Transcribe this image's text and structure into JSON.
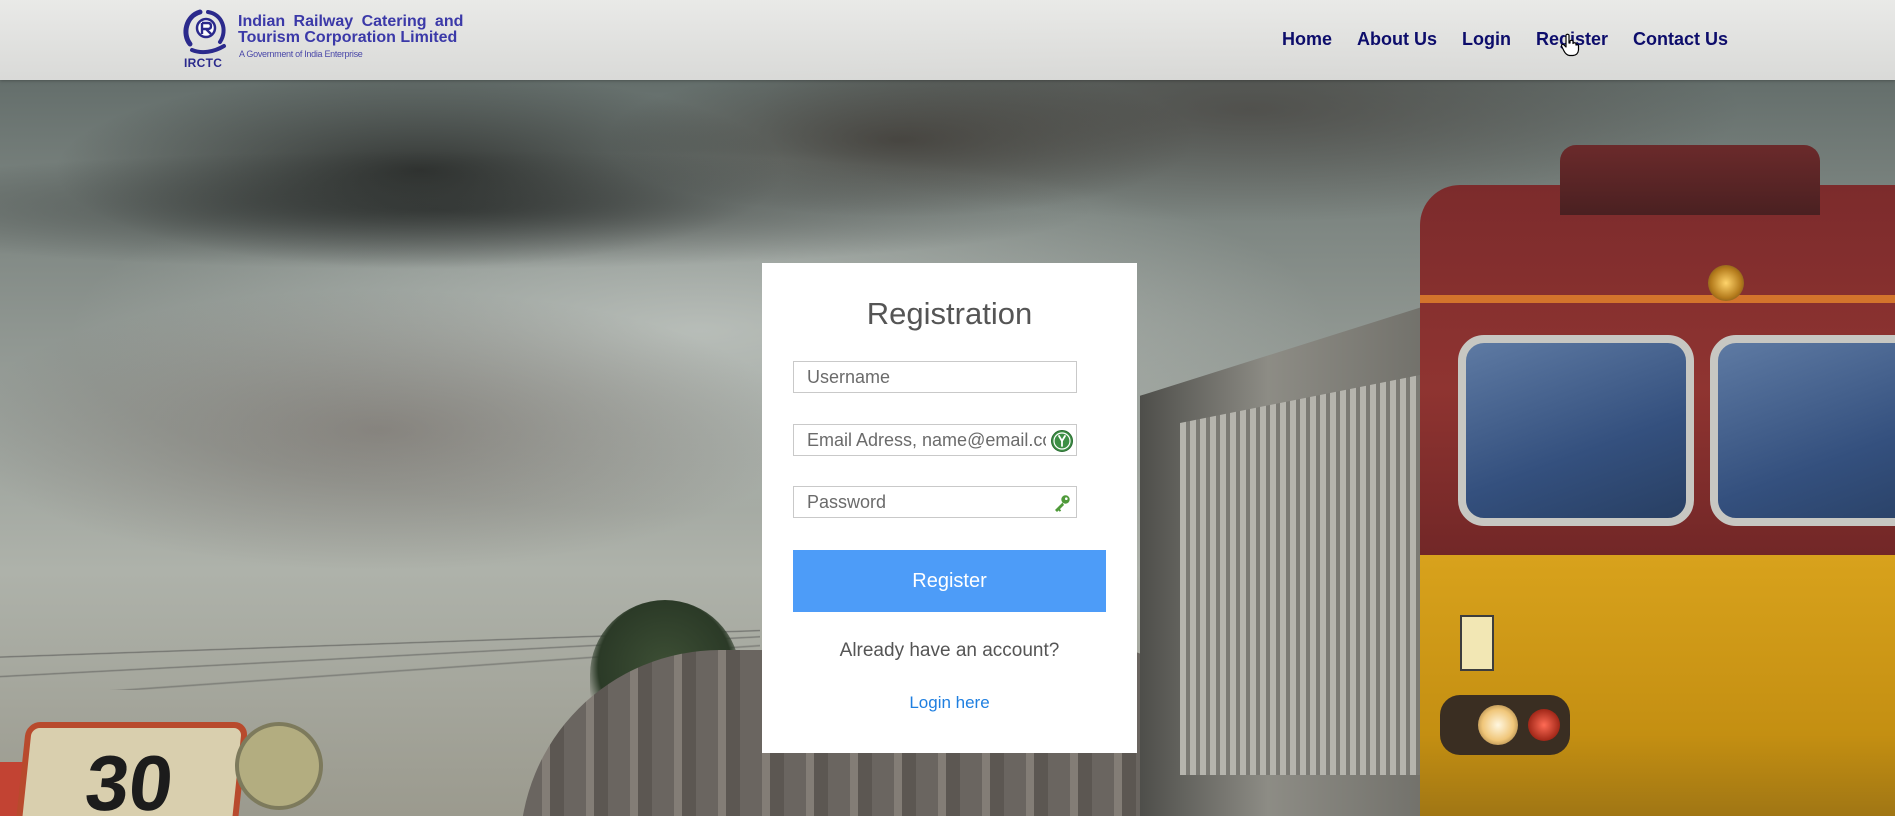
{
  "header": {
    "logo": {
      "abbr": "IRCTC",
      "title_line1": "Indian Railway Catering and",
      "title_line2": "Tourism Corporation Limited",
      "subtitle": "A Government of India Enterprise",
      "brand_color": "#3b39a8"
    },
    "nav": {
      "items": [
        {
          "label": "Home"
        },
        {
          "label": "About Us"
        },
        {
          "label": "Login"
        },
        {
          "label": "Register"
        },
        {
          "label": "Contact Us"
        }
      ],
      "color": "#0d0d6b"
    }
  },
  "registration": {
    "title": "Registration",
    "username": {
      "value": "",
      "placeholder": "Username"
    },
    "email": {
      "value": "",
      "placeholder": "Email Adress, name@email.com",
      "icon": "password-manager-icon"
    },
    "password": {
      "value": "",
      "placeholder": "Password",
      "icon": "key-icon"
    },
    "submit_label": "Register",
    "already_text": "Already have an account?",
    "login_link_label": "Login here",
    "accent_color": "#4d9cf8",
    "link_color": "#1f7fe0"
  }
}
